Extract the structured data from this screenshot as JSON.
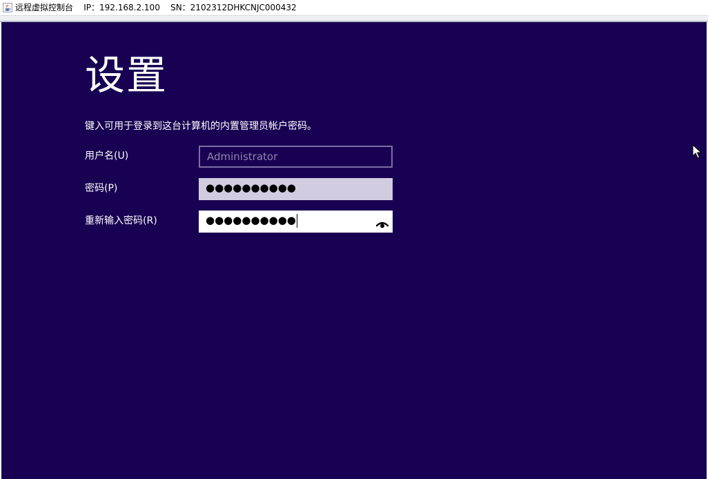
{
  "window": {
    "title": "远程虚拟控制台    IP：192.168.2.100    SN：2102312DHKCNJC000432",
    "icon": "java-coffee-icon"
  },
  "setup": {
    "heading": "设置",
    "instruction": "键入可用于登录到这台计算机的内置管理员帐户密码。",
    "fields": {
      "username": {
        "label": "用户名(U)",
        "placeholder": "Administrator"
      },
      "password": {
        "label": "密码(P)",
        "masked_value": "●●●●●●●●●●"
      },
      "reenter_password": {
        "label": "重新输入密码(R)",
        "masked_value": "●●●●●●●●●●",
        "reveal_icon": "eye-icon"
      }
    }
  },
  "colors": {
    "background": "#180052",
    "text": "#ffffff",
    "field_border": "#7e6fa6",
    "field_inactive": "#d1cce0",
    "field_active": "#ffffff"
  }
}
